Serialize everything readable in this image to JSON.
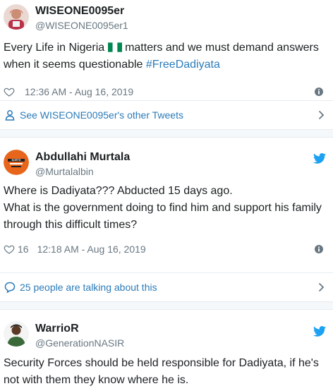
{
  "tweets": [
    {
      "name": "WISEONE0095er",
      "handle": "@WISEONE0095er1",
      "text_before_flag": "Every Life in Nigeria ",
      "text_after_flag": " matters and we must demand answers when it seems questionable ",
      "hashtag": "#FreeDadiyata",
      "likes": "",
      "timestamp": "12:36 AM - Aug 16, 2019",
      "footer": "See WISEONE0095er's other Tweets"
    },
    {
      "name": "Abdullahi Murtala",
      "handle": "@Murtalalbin",
      "avatar_text": "NORTH",
      "text": "Where is Dadiyata??? Abducted 15 days ago.\nWhat is the government doing to find him and support his family through this difficult times?",
      "likes": "16",
      "timestamp": "12:18 AM - Aug 16, 2019",
      "footer": "25 people are talking about this"
    },
    {
      "name": "WarrioR",
      "handle": "@GenerationNASIR",
      "text": "Security Forces should be held responsible for Dadiyata, if he's not with them they know where he is."
    }
  ],
  "colors": {
    "link": "#2b7bb9",
    "twitter_blue": "#1da1f2",
    "muted": "#697882",
    "border": "#e6ecf0",
    "flag_green": "#008751"
  },
  "icons": [
    "heart-icon",
    "info-icon",
    "person-icon",
    "chevron-right-icon",
    "comment-icon",
    "twitter-bird-icon"
  ]
}
